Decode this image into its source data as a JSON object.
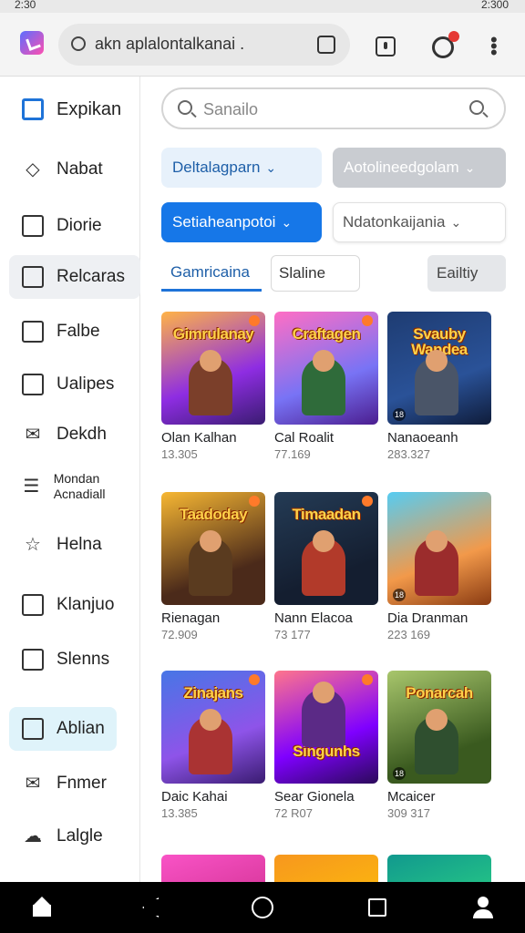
{
  "status": {
    "time": "2:30",
    "right": "2:300"
  },
  "browser": {
    "url": "akn aplalontalkanai ."
  },
  "sidebar": {
    "items": [
      {
        "label": "Expikan",
        "icon": "clipboard-icon"
      },
      {
        "label": "Nabat",
        "icon": "tag-icon"
      },
      {
        "label": "Diorie",
        "icon": "image-icon"
      },
      {
        "label": "Relcaras",
        "icon": "folder-icon"
      },
      {
        "label": "Falbe",
        "icon": "phone-icon"
      },
      {
        "label": "Ualipes",
        "icon": "gallery-icon"
      },
      {
        "label": "Dekdh",
        "icon": "mail-icon"
      },
      {
        "label": "Mondan Acnadiall",
        "icon": "list-icon"
      },
      {
        "label": "Helna",
        "icon": "star-icon"
      },
      {
        "label": "Klanjuo",
        "icon": "building-icon"
      },
      {
        "label": "Slenns",
        "icon": "columns-icon"
      },
      {
        "label": "Ablian",
        "icon": "window-icon"
      },
      {
        "label": "Fnmer",
        "icon": "mail-icon"
      },
      {
        "label": "Lalgle",
        "icon": "cloud-icon"
      }
    ]
  },
  "search": {
    "placeholder": "Sanailo"
  },
  "filters": {
    "chip1": "Deltalagparn",
    "chip2": "Aotolineedgolam",
    "chip3": "Setiaheanpotoi",
    "chip4": "Ndatonkaijania"
  },
  "tabs": {
    "tab1": "Gamricaina",
    "tab2": "Slaline",
    "tab3": "Eailtiy"
  },
  "games": [
    {
      "title": "Gimrulanay",
      "name": "Olan Kalhan",
      "num": "13.305"
    },
    {
      "title": "Craftagen",
      "name": "Cal Roalit",
      "num": "77.169"
    },
    {
      "title": "Svauby Wandea",
      "name": "Nanaoeanh",
      "num": "283.327"
    },
    {
      "title": "Taadoday",
      "name": "Rienagan",
      "num": "72.909"
    },
    {
      "title": "Timaadan",
      "name": "Nann Elacoa",
      "num": "73 177"
    },
    {
      "title": "",
      "name": "Dia Dranman",
      "num": "223 169"
    },
    {
      "title": "Zinajans",
      "name": "Daic Kahai",
      "num": "13.385"
    },
    {
      "title": "Singunhs",
      "name": "Sear Gionela",
      "num": "72 R07"
    },
    {
      "title": "Ponarcah",
      "name": "Mcaicer",
      "num": "309 317"
    }
  ]
}
